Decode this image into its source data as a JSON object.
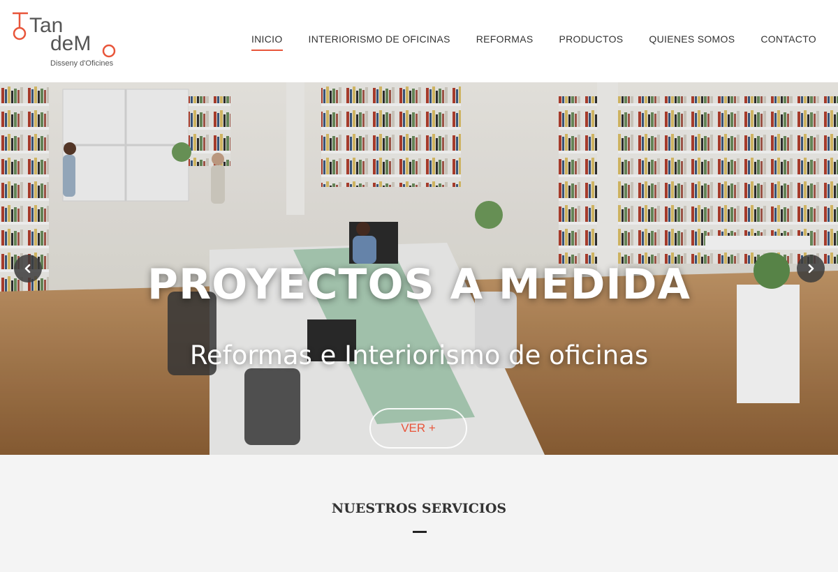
{
  "brand": {
    "logo_line1": "Tan",
    "logo_line2": "deM",
    "tagline": "Disseny d'Oficines",
    "accent_color": "#e8553a"
  },
  "nav": {
    "items": [
      {
        "label": "INICIO",
        "active": true
      },
      {
        "label": "INTERIORISMO DE OFICINAS",
        "active": false
      },
      {
        "label": "REFORMAS",
        "active": false
      },
      {
        "label": "PRODUCTOS",
        "active": false
      },
      {
        "label": "QUIENES SOMOS",
        "active": false
      },
      {
        "label": "CONTACTO",
        "active": false
      }
    ]
  },
  "hero": {
    "title": "PROYECTOS A MEDIDA",
    "subtitle": "Reformas e Interiorismo de oficinas",
    "button_label": "VER +",
    "prev_icon": "chevron-left-icon",
    "next_icon": "chevron-right-icon"
  },
  "services": {
    "heading": "NUESTROS SERVICIOS"
  }
}
